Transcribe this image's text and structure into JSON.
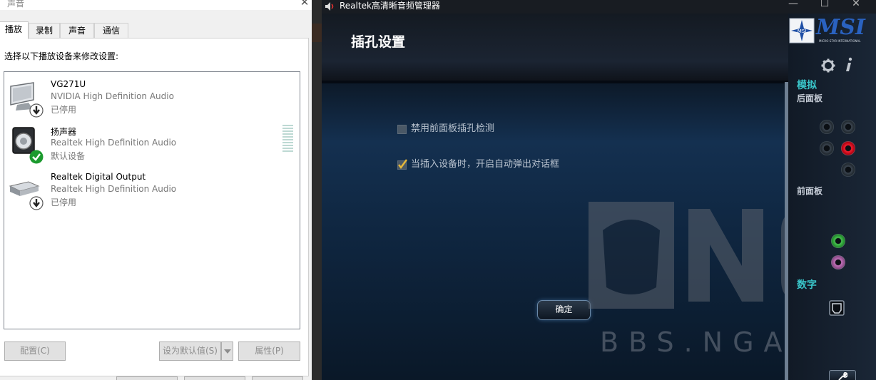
{
  "sound_dialog": {
    "title": "声音",
    "close_glyph": "✕",
    "tabs": [
      {
        "label": "播放",
        "active": true
      },
      {
        "label": "录制",
        "active": false
      },
      {
        "label": "声音",
        "active": false
      },
      {
        "label": "通信",
        "active": false
      }
    ],
    "instruction": "选择以下播放设备来修改设置:",
    "devices": [
      {
        "name": "VG271U",
        "driver": "NVIDIA High Definition Audio",
        "status": "已停用",
        "icon": "monitor-icon",
        "badge": "down-arrow-badge"
      },
      {
        "name": "扬声器",
        "driver": "Realtek High Definition Audio",
        "status": "默认设备",
        "icon": "speaker-icon",
        "badge": "check-badge"
      },
      {
        "name": "Realtek Digital Output",
        "driver": "Realtek High Definition Audio",
        "status": "已停用",
        "icon": "digital-output-icon",
        "badge": "down-arrow-badge"
      }
    ],
    "buttons": {
      "configure": "配置(C)",
      "set_default": "设为默认值(S)",
      "properties": "属性(P)"
    }
  },
  "realtek": {
    "window_title": "Realtek高清晰音频管理器",
    "window_controls": {
      "minimize": "—",
      "maximize": "☐",
      "close": "✕"
    },
    "page_title": "插孔设置",
    "options": [
      {
        "label": "禁用前面板插孔检测",
        "checked": false
      },
      {
        "label": "当插入设备时，开启自动弹出对话框",
        "checked": true
      }
    ],
    "ok_button": "确定",
    "brand": "MSI",
    "brand_sub": "MICRO-STAR INTERNATIONAL",
    "side": {
      "analog": "模拟",
      "rear_panel": "后面板",
      "front_panel": "前面板",
      "digital": "数字"
    },
    "watermark": "BBS.NGA.CN",
    "colors": {
      "accent_cyan": "#3ac5c9",
      "jack_red": "#f02030",
      "jack_green": "#48c050",
      "jack_pink": "#c070b8"
    }
  }
}
